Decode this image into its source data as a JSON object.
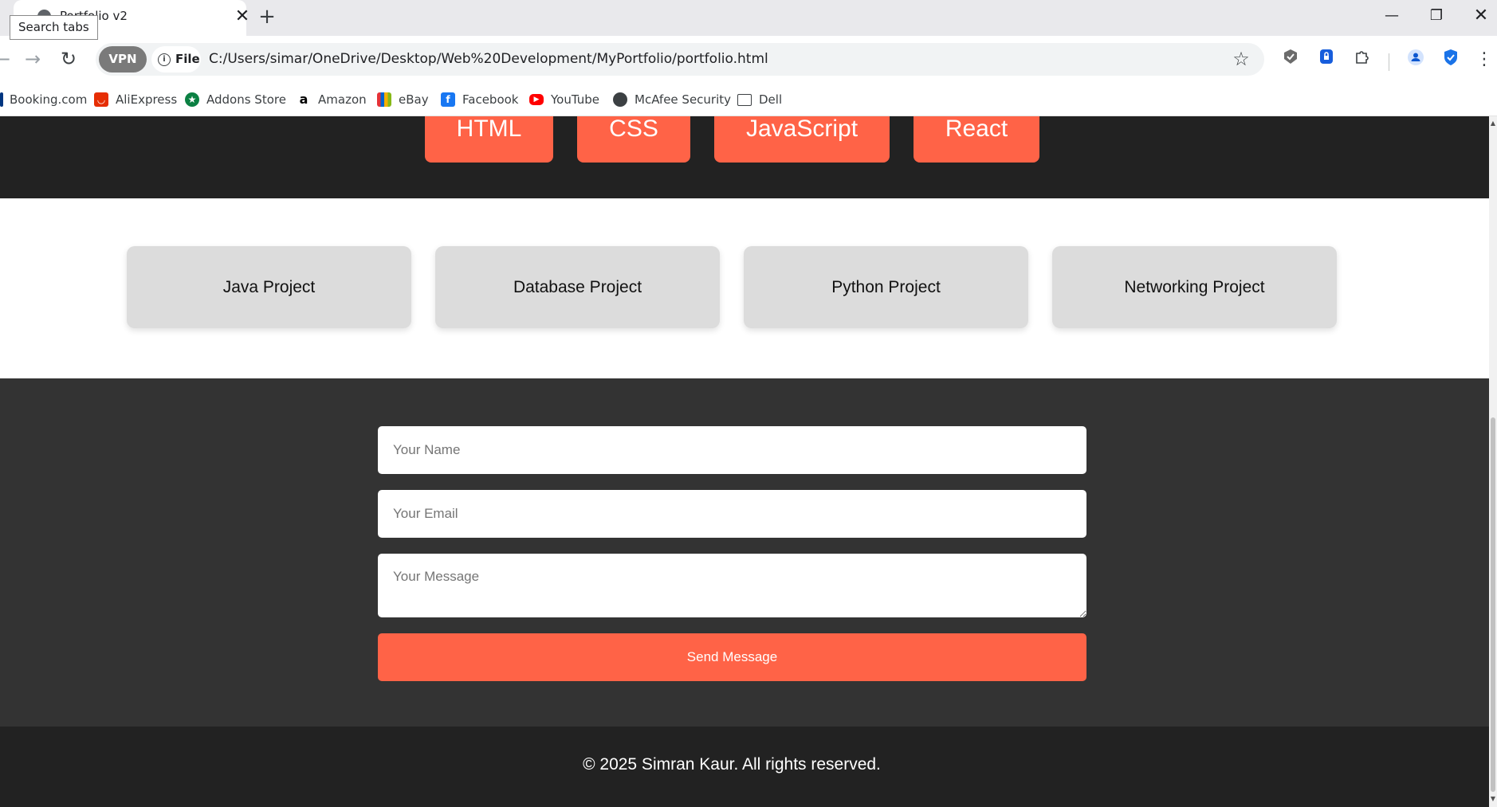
{
  "browser": {
    "tab_title": "Portfolio v2",
    "tooltip": "Search tabs",
    "new_tab_symbol": "+",
    "close_symbol": "✕",
    "window_controls": {
      "minimize": "—",
      "restore": "❐",
      "close": "✕"
    },
    "vpn_label": "VPN",
    "file_label": "File",
    "url": "C:/Users/simar/OneDrive/Desktop/Web%20Development/MyPortfolio/portfolio.html",
    "bookmarks": [
      {
        "label": "Booking.com",
        "icon": "booking-icon",
        "color": "#003580"
      },
      {
        "label": "AliExpress",
        "icon": "aliexpress-icon",
        "color": "#e62e04"
      },
      {
        "label": "Addons Store",
        "icon": "addons-store-icon",
        "color": "#0b8043"
      },
      {
        "label": "Amazon",
        "icon": "amazon-icon",
        "color": "#000000"
      },
      {
        "label": "eBay",
        "icon": "ebay-icon",
        "color": "#e53238"
      },
      {
        "label": "Facebook",
        "icon": "facebook-icon",
        "color": "#1877f2"
      },
      {
        "label": "YouTube",
        "icon": "youtube-icon",
        "color": "#ff0000"
      },
      {
        "label": "McAfee Security",
        "icon": "mcafee-globe-icon",
        "color": "#3c4043"
      },
      {
        "label": "Dell",
        "icon": "folder-icon",
        "color": "#3c4043"
      }
    ]
  },
  "page": {
    "skills": [
      "HTML",
      "CSS",
      "JavaScript",
      "React"
    ],
    "projects": [
      "Java Project",
      "Database Project",
      "Python Project",
      "Networking Project"
    ],
    "contact": {
      "name_placeholder": "Your Name",
      "email_placeholder": "Your Email",
      "message_placeholder": "Your Message",
      "send_label": "Send Message"
    },
    "footer": "© 2025 Simran Kaur. All rights reserved."
  },
  "colors": {
    "accent": "#ff6347",
    "dark_section": "#222222",
    "contact_background": "#333333",
    "card_background": "#dcdcdc"
  }
}
